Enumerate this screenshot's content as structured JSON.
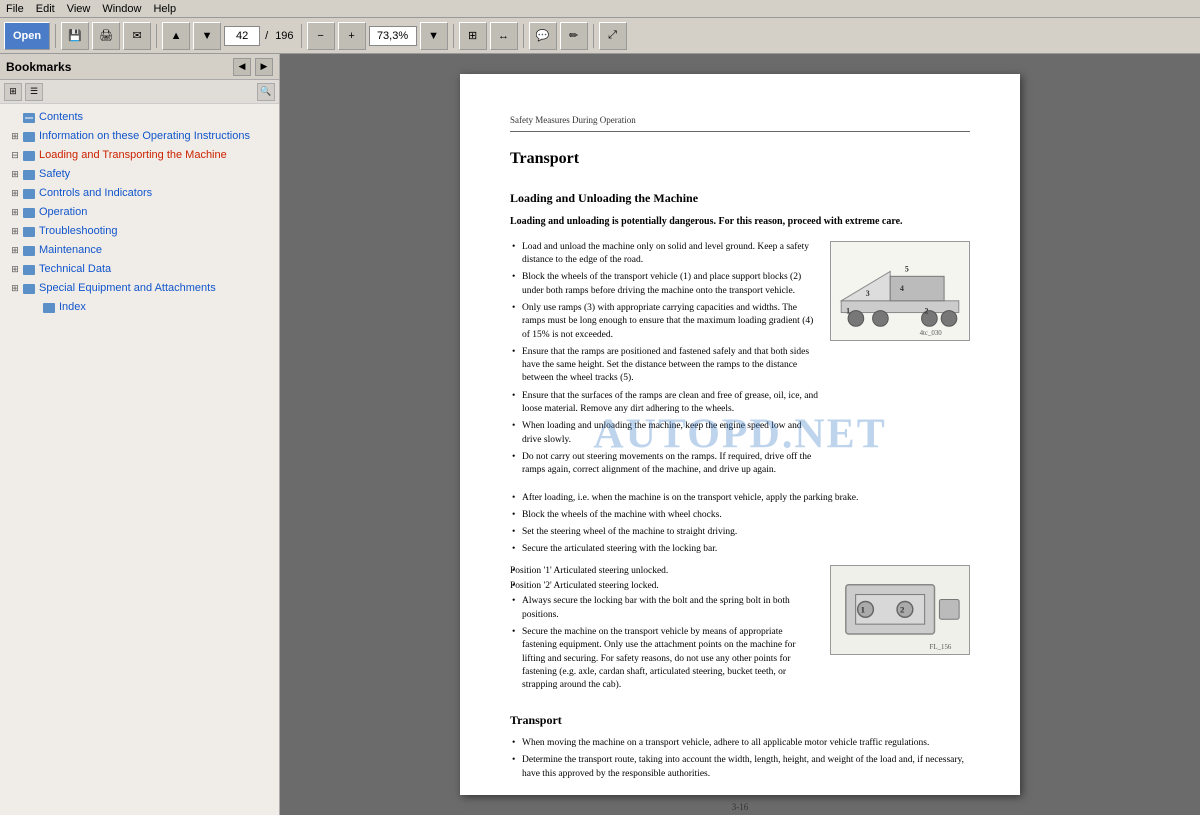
{
  "menu": {
    "items": [
      "File",
      "Edit",
      "View",
      "Window",
      "Help"
    ]
  },
  "toolbar": {
    "open_label": "Open",
    "page_current": "42",
    "page_separator": "/",
    "page_total": "196",
    "zoom_value": "73,3%"
  },
  "left_panel": {
    "title": "Bookmarks",
    "tree_items": [
      {
        "id": "contents",
        "label": "Contents",
        "level": 0,
        "expandable": false,
        "has_icon": true
      },
      {
        "id": "info",
        "label": "Information on these Operating Instructions",
        "level": 0,
        "expandable": true,
        "has_icon": true
      },
      {
        "id": "loading",
        "label": "Loading and Transporting the Machine",
        "level": 0,
        "expandable": true,
        "has_icon": true,
        "active": true
      },
      {
        "id": "safety",
        "label": "Safety",
        "level": 0,
        "expandable": true,
        "has_icon": true
      },
      {
        "id": "controls",
        "label": "Controls and Indicators",
        "level": 0,
        "expandable": true,
        "has_icon": true
      },
      {
        "id": "operation",
        "label": "Operation",
        "level": 0,
        "expandable": true,
        "has_icon": true
      },
      {
        "id": "troubleshooting",
        "label": "Troubleshooting",
        "level": 0,
        "expandable": true,
        "has_icon": true
      },
      {
        "id": "maintenance",
        "label": "Maintenance",
        "level": 0,
        "expandable": true,
        "has_icon": true
      },
      {
        "id": "technical",
        "label": "Technical Data",
        "level": 0,
        "expandable": true,
        "has_icon": true
      },
      {
        "id": "special",
        "label": "Special Equipment and Attachments",
        "level": 0,
        "expandable": true,
        "has_icon": true
      },
      {
        "id": "index",
        "label": "Index",
        "level": 0,
        "expandable": false,
        "has_icon": true
      }
    ]
  },
  "pdf_page": {
    "header": "Safety Measures During Operation",
    "section_title": "Transport",
    "subsection1_title": "Loading and Unloading the Machine",
    "warning_text": "Loading and unloading is potentially dangerous. For this reason, proceed with extreme care.",
    "bullets_col1": [
      "Load and unload the machine only on solid and level ground. Keep a safety distance to the edge of the road.",
      "Block the wheels of the transport vehicle (1) and place support blocks (2) under both ramps before driving the machine onto the transport vehicle.",
      "Only use ramps (3) with appropriate carrying capacities and widths. The ramps must be long enough to ensure that the maximum loading gradient (4) of 15% is not exceeded.",
      "Ensure that the ramps are positioned and fastened safely and that both sides have the same height. Set the distance between the ramps to the distance between the wheel tracks (5).",
      "Ensure that the surfaces of the ramps are clean and free of grease, oil, ice, and loose material. Remove any dirt adhering to the wheels.",
      "When loading and unloading the machine, keep the engine speed low and drive slowly.",
      "Do not carry out steering movements on the ramps. If required, drive off the ramps again, correct alignment of the machine, and drive up again.",
      "After loading, i.e. when the machine is on the transport vehicle, apply the parking brake.",
      "Block the wheels of the machine with wheel chocks.",
      "Set the steering wheel of the machine to straight driving.",
      "Secure the articulated steering with the locking bar.",
      "Position '1'    Articulated steering unlocked.",
      "Position '2'    Articulated steering locked.",
      "Always secure the locking bar with the bolt and the spring bolt in both positions.",
      "Secure the machine on the transport vehicle by means of appropriate fastening equipment. Only use the attachment points on the machine for lifting and securing. For safety reasons, do not use any other points for fastening (e.g. axle, cardan shaft, articulated steering, bucket teeth, or strapping around the cab)."
    ],
    "image1_caption": "4tc_030",
    "image2_caption": "FL_156",
    "transport_section_title": "Transport",
    "transport_bullets": [
      "When moving the machine on a transport vehicle, adhere to all applicable motor vehicle traffic regulations.",
      "Determine the transport route, taking into account the width, length, height, and weight of the load and, if necessary, have this approved by the responsible authorities."
    ],
    "watermark": "AUTOPD.NET",
    "footer": "3-16"
  }
}
